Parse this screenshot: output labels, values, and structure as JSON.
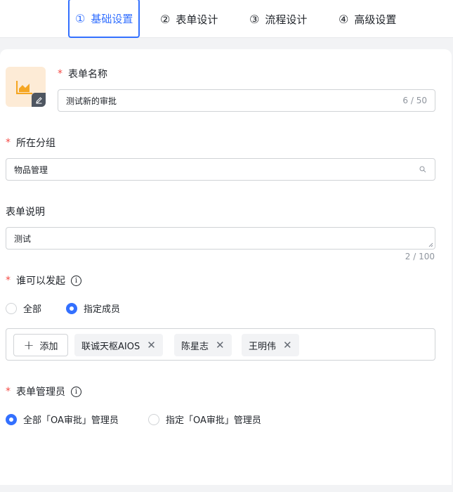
{
  "steps": [
    {
      "num": "①",
      "label": "基础设置"
    },
    {
      "num": "②",
      "label": "表单设计"
    },
    {
      "num": "③",
      "label": "流程设计"
    },
    {
      "num": "④",
      "label": "高级设置"
    }
  ],
  "form": {
    "name_label": "表单名称",
    "name_value": "测试新的审批",
    "name_counter": "6 / 50",
    "group_label": "所在分组",
    "group_value": "物品管理",
    "desc_label": "表单说明",
    "desc_value": "测试",
    "desc_counter": "2 / 100",
    "initiator_label": "谁可以发起",
    "initiator_options": [
      "全部",
      "指定成员"
    ],
    "add_button": "添加",
    "members": [
      "联诚天枢AIOS",
      "陈星志",
      "王明伟"
    ],
    "admin_label": "表单管理员",
    "admin_options": [
      "全部「OA审批」管理员",
      "指定「OA审批」管理员"
    ]
  },
  "colors": {
    "accent": "#3370ff",
    "required": "#f54a45",
    "avatar_bg": "#fdebd6",
    "chart_icon": "#f5a623"
  },
  "icons": [
    "chart-icon",
    "edit-icon",
    "search-icon",
    "info-icon",
    "plus-icon",
    "close-icon"
  ]
}
